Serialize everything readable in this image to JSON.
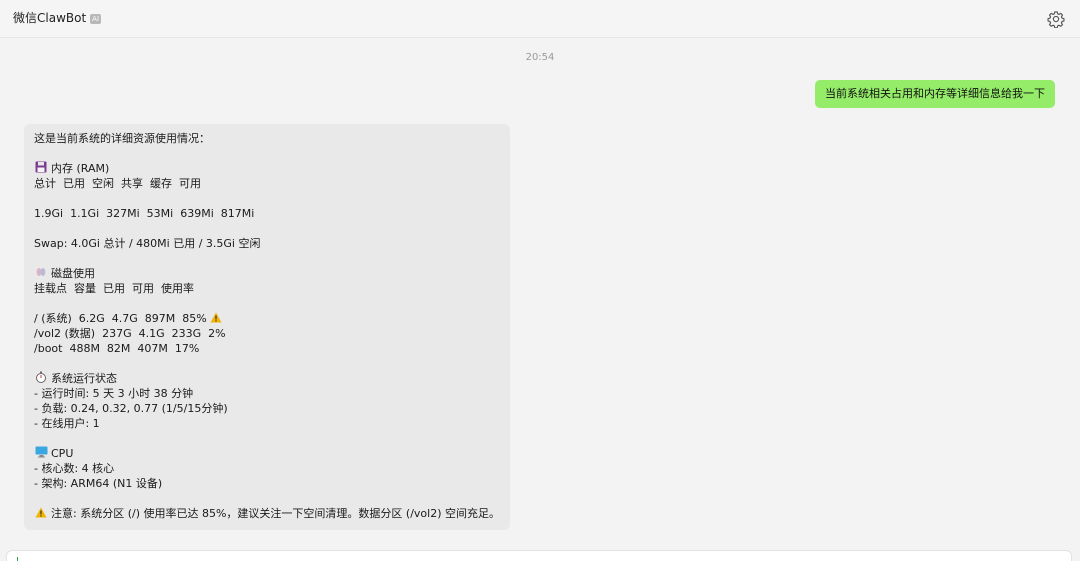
{
  "window": {
    "title": "微信ClawBot",
    "badge": "AI",
    "settings_icon": "gear-icon"
  },
  "chat": {
    "timestamp": "20:54",
    "user_message": "当前系统相关占用和内存等详细信息给我一下",
    "reply": {
      "intro": "这是当前系统的详细资源使用情况：",
      "memory": {
        "icon": "floppy-disk-icon",
        "title": "内存 (RAM)",
        "header": "总计  已用  空闲  共享  缓存  可用",
        "values": "1.9Gi  1.1Gi  327Mi  53Mi  639Mi  817Mi",
        "swap": "Swap: 4.0Gi 总计 / 480Mi 已用 / 3.5Gi 空闲"
      },
      "disk": {
        "icon": "disk-icon",
        "title": "磁盘使用",
        "header": "挂载点  容量  已用  可用  使用率",
        "rows": [
          "/ (系统)  6.2G  4.7G  897M  85% ",
          "/vol2 (数据)  237G  4.1G  233G  2%",
          "/boot  488M  82M  407M  17%"
        ],
        "warning_icon": "⚠️"
      },
      "system": {
        "icon": "stopwatch-icon",
        "title": "系统运行状态",
        "items": [
          "- 运行时间: 5 天 3 小时 38 分钟",
          "- 负载: 0.24, 0.32, 0.77 (1/5/15分钟)",
          "- 在线用户: 1"
        ]
      },
      "cpu": {
        "icon": "computer-icon",
        "title": "CPU",
        "items": [
          "- 核心数: 4 核心",
          "- 架构: ARM64 (N1 设备)"
        ]
      },
      "note": {
        "icon": "warning-icon",
        "text": "注意: 系统分区 (/) 使用率已达 85%，建议关注一下空间清理。数据分区 (/vol2) 空间充足。"
      }
    }
  },
  "colors": {
    "user_bubble": "#95ec69",
    "bot_bubble": "#e9e9e9",
    "background": "#f3f3f3"
  }
}
